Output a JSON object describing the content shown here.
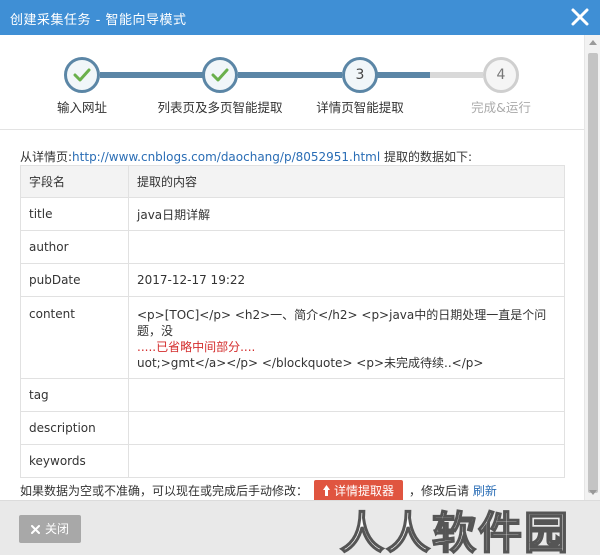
{
  "window": {
    "title": "创建采集任务 - 智能向导模式",
    "close_icon": "close-icon"
  },
  "steps": [
    {
      "label": "输入网址",
      "state": "done"
    },
    {
      "label": "列表页及多页智能提取",
      "state": "done"
    },
    {
      "label": "详情页智能提取",
      "state": "current",
      "number": "3"
    },
    {
      "label": "完成&运行",
      "state": "todo",
      "number": "4"
    }
  ],
  "source": {
    "prefix": "从详情页:",
    "url": "http://www.cnblogs.com/daochang/p/8052951.html",
    "suffix": " 提取的数据如下:"
  },
  "table": {
    "headers": [
      "字段名",
      "提取的内容"
    ],
    "rows": [
      {
        "name": "title",
        "value": "java日期详解"
      },
      {
        "name": "author",
        "value": ""
      },
      {
        "name": "pubDate",
        "value": "2017-12-17 19:22"
      },
      {
        "name": "content",
        "value_line1": "<p>[TOC]</p> <h2>一、简介</h2> <p>java中的日期处理一直是个问题，没",
        "value_omitted": ".....已省略中间部分....",
        "value_line2": "uot;>gmt</a></p> </blockquote> <p>未完成待续..</p>"
      },
      {
        "name": "tag",
        "value": ""
      },
      {
        "name": "description",
        "value": ""
      },
      {
        "name": "keywords",
        "value": ""
      }
    ]
  },
  "footer": {
    "hint": "如果数据为空或不准确，可以现在或完成后手动修改：",
    "picker_label": "详情提取器",
    "after": "，修改后请",
    "refresh_label": "刷新"
  },
  "bottom": {
    "close_label": "关闭",
    "watermark": "人人软件园"
  },
  "colors": {
    "titlebar": "#3f8fd5",
    "step_done": "#5b86a6",
    "step_todo": "#d9d9d9",
    "picker": "#e05540",
    "link": "#2a6db5",
    "omitted": "#d42d2d"
  }
}
